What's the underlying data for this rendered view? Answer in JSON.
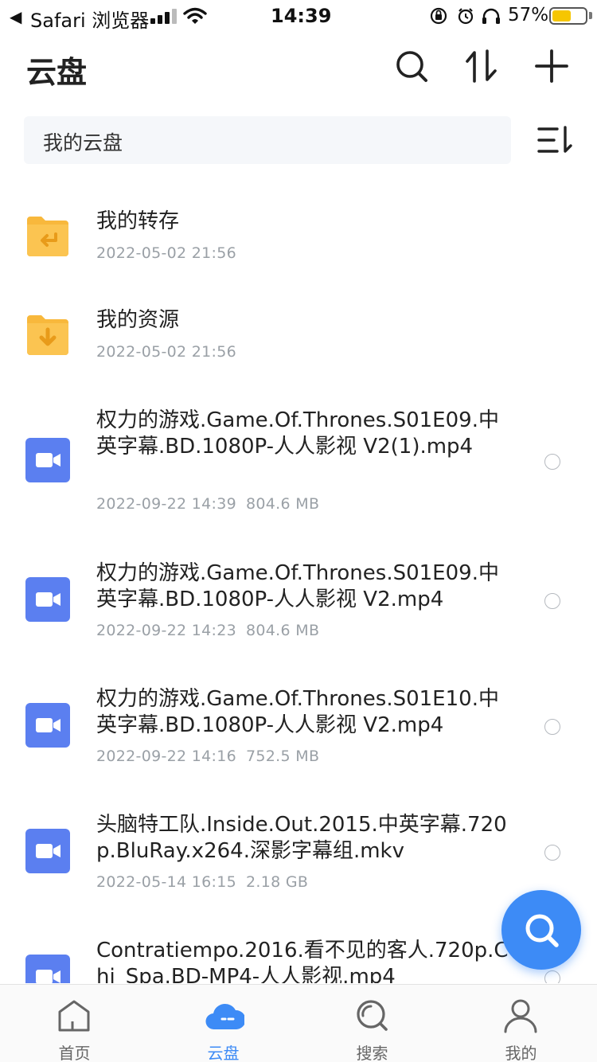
{
  "status_bar": {
    "back_app": "Safari 浏览器",
    "time": "14:39",
    "battery_percent": "57%",
    "battery_level": 0.57
  },
  "header": {
    "title": "云盘"
  },
  "path_bar": {
    "current": "我的云盘"
  },
  "files": [
    {
      "type": "folder",
      "variant": "transfer",
      "name": "我的转存",
      "date": "2022-05-02 21:56",
      "size": ""
    },
    {
      "type": "folder",
      "variant": "resource",
      "name": "我的资源",
      "date": "2022-05-02 21:56",
      "size": ""
    },
    {
      "type": "video",
      "name": "权力的游戏.Game.Of.Thrones.S01E09.中英字幕.BD.1080P-人人影视 V2(1).mp4",
      "date": "2022-09-22 14:39",
      "size": "804.6 MB"
    },
    {
      "type": "video",
      "name": "权力的游戏.Game.Of.Thrones.S01E09.中英字幕.BD.1080P-人人影视 V2.mp4",
      "date": "2022-09-22 14:23",
      "size": "804.6 MB"
    },
    {
      "type": "video",
      "name": "权力的游戏.Game.Of.Thrones.S01E10.中英字幕.BD.1080P-人人影视 V2.mp4",
      "date": "2022-09-22 14:16",
      "size": "752.5 MB"
    },
    {
      "type": "video",
      "name": "头脑特工队.Inside.Out.2015.中英字幕.720p.BluRay.x264.深影字幕组.mkv",
      "date": "2022-05-14 16:15",
      "size": "2.18 GB"
    },
    {
      "type": "video",
      "name": "Contratiempo.2016.看不见的客人.720p.Chi_Spa.BD-MP4-人人影视.mp4",
      "date": "",
      "size": ""
    }
  ],
  "tabs": [
    {
      "label": "首页",
      "icon": "home-icon",
      "active": false
    },
    {
      "label": "云盘",
      "icon": "cloud-icon",
      "active": true
    },
    {
      "label": "搜索",
      "icon": "search-icon",
      "active": false
    },
    {
      "label": "我的",
      "icon": "profile-icon",
      "active": false
    }
  ],
  "colors": {
    "accent": "#3d8bf6",
    "folder": "#f8b83c",
    "video": "#5b7ff0"
  }
}
